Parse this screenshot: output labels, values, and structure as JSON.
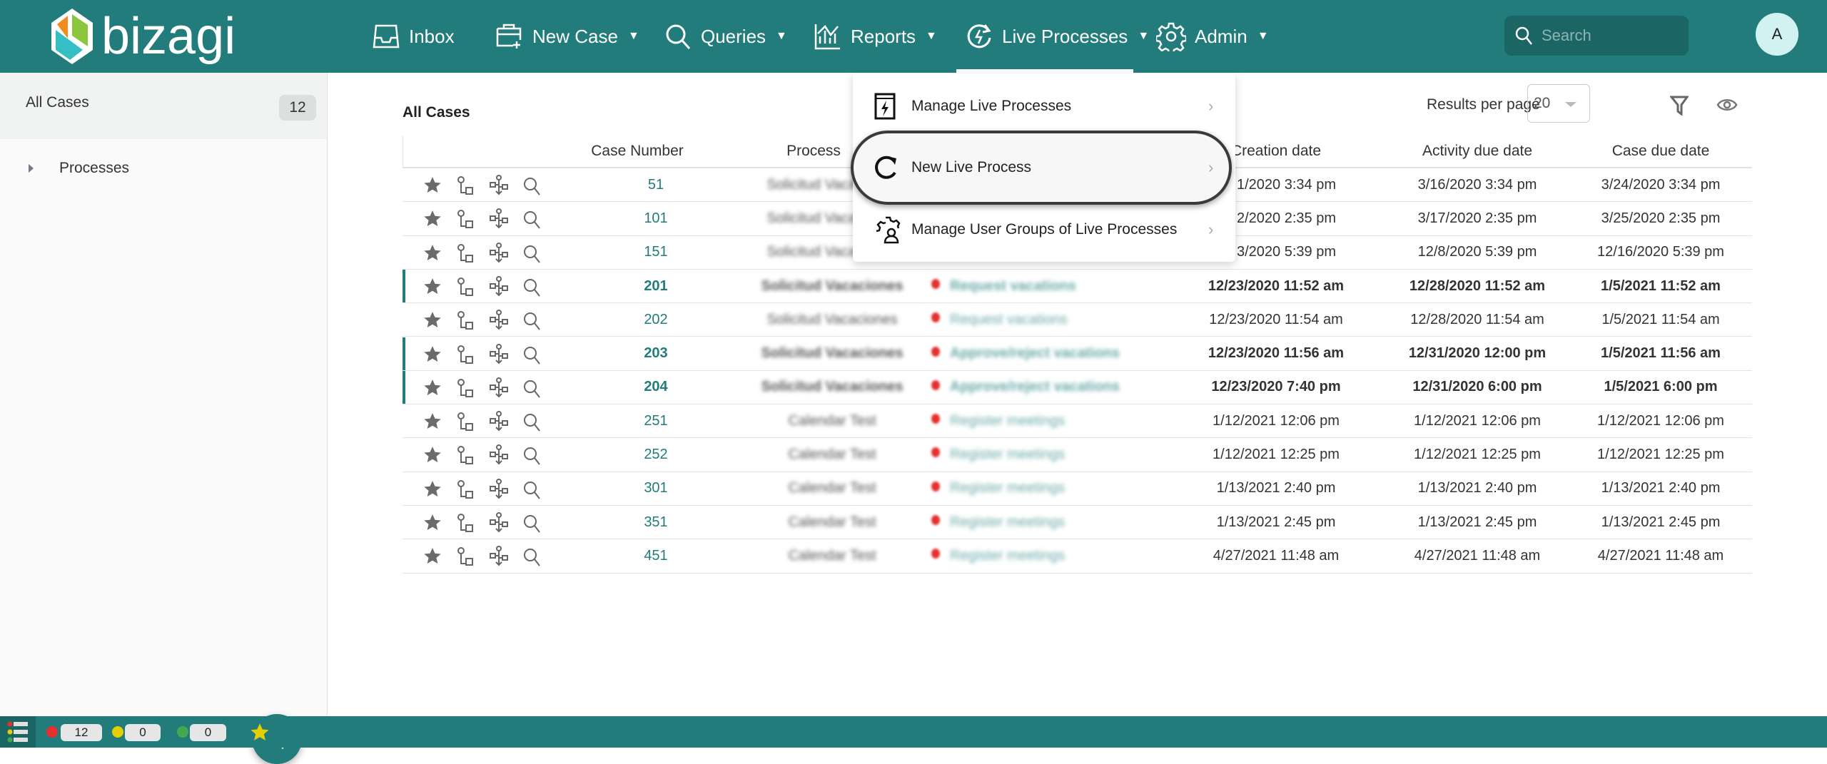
{
  "header": {
    "brand": "bizagi",
    "nav": [
      {
        "label": "Inbox",
        "icon": "inbox-icon"
      },
      {
        "label": "New Case",
        "icon": "new-case-icon"
      },
      {
        "label": "Queries",
        "icon": "search-icon"
      },
      {
        "label": "Reports",
        "icon": "chart-icon"
      },
      {
        "label": "Live Processes",
        "icon": "live-processes-icon",
        "active": true
      },
      {
        "label": "Admin",
        "icon": "gear-icon"
      }
    ],
    "search_placeholder": "Search",
    "avatar": "A",
    "color": "#227c7c"
  },
  "sidebar": {
    "all_cases": "All Cases",
    "all_cases_count": "12",
    "processes": "Processes"
  },
  "main": {
    "title": "All Cases",
    "results_per_page_label": "Results per page",
    "results_per_page": "20",
    "columns": [
      "Case Number",
      "Process",
      "Creation date",
      "Activity due date",
      "Case due date"
    ],
    "columns_visible": {
      "creation": "reation date"
    },
    "rows": [
      {
        "case": "51",
        "process": "Solicitud Vacaciones",
        "activity": "",
        "creation": "1/2020 3:34 pm",
        "activity_due": "3/16/2020 3:34 pm",
        "case_due": "3/24/2020 3:34 pm",
        "bold": false,
        "partial": true
      },
      {
        "case": "101",
        "process": "Solicitud Vacaciones",
        "activity": "",
        "creation": "2/2020 2:35 pm",
        "activity_due": "3/17/2020 2:35 pm",
        "case_due": "3/25/2020 2:35 pm",
        "bold": false,
        "partial": true
      },
      {
        "case": "151",
        "process": "Solicitud Vacaciones",
        "activity": "",
        "creation": "3/2020 5:39 pm",
        "activity_due": "12/8/2020 5:39 pm",
        "case_due": "12/16/2020 5:39 pm",
        "bold": false,
        "partial": true
      },
      {
        "case": "201",
        "process": "Solicitud Vacaciones",
        "activity": "Request vacations",
        "creation": "12/23/2020 11:52 am",
        "activity_due": "12/28/2020 11:52 am",
        "case_due": "1/5/2021 11:52 am",
        "bold": true
      },
      {
        "case": "202",
        "process": "Solicitud Vacaciones",
        "activity": "Request vacations",
        "creation": "12/23/2020 11:54 am",
        "activity_due": "12/28/2020 11:54 am",
        "case_due": "1/5/2021 11:54 am",
        "bold": false
      },
      {
        "case": "203",
        "process": "Solicitud Vacaciones",
        "activity": "Approve/reject vacations",
        "creation": "12/23/2020 11:56 am",
        "activity_due": "12/31/2020 12:00 pm",
        "case_due": "1/5/2021 11:56 am",
        "bold": true
      },
      {
        "case": "204",
        "process": "Solicitud Vacaciones",
        "activity": "Approve/reject vacations",
        "creation": "12/23/2020 7:40 pm",
        "activity_due": "12/31/2020 6:00 pm",
        "case_due": "1/5/2021 6:00 pm",
        "bold": true
      },
      {
        "case": "251",
        "process": "Calendar Test",
        "activity": "Register meetings",
        "creation": "1/12/2021 12:06 pm",
        "activity_due": "1/12/2021 12:06 pm",
        "case_due": "1/12/2021 12:06 pm",
        "bold": false
      },
      {
        "case": "252",
        "process": "Calendar Test",
        "activity": "Register meetings",
        "creation": "1/12/2021 12:25 pm",
        "activity_due": "1/12/2021 12:25 pm",
        "case_due": "1/12/2021 12:25 pm",
        "bold": false
      },
      {
        "case": "301",
        "process": "Calendar Test",
        "activity": "Register meetings",
        "creation": "1/13/2021 2:40 pm",
        "activity_due": "1/13/2021 2:40 pm",
        "case_due": "1/13/2021 2:40 pm",
        "bold": false
      },
      {
        "case": "351",
        "process": "Calendar Test",
        "activity": "Register meetings",
        "creation": "1/13/2021 2:45 pm",
        "activity_due": "1/13/2021 2:45 pm",
        "case_due": "1/13/2021 2:45 pm",
        "bold": false
      },
      {
        "case": "451",
        "process": "Calendar Test",
        "activity": "Register meetings",
        "creation": "4/27/2021 11:48 am",
        "activity_due": "4/27/2021 11:48 am",
        "case_due": "4/27/2021 11:48 am",
        "bold": false
      }
    ]
  },
  "menu": {
    "items": [
      {
        "label": "Manage Live Processes",
        "icon": "lightning-window-icon"
      },
      {
        "label": "New Live Process",
        "icon": "refresh-icon",
        "highlighted": true
      },
      {
        "label": "Manage User Groups of Live Processes",
        "icon": "user-gear-icon"
      }
    ]
  },
  "footer": {
    "red_count": "12",
    "yellow_count": "0",
    "green_count": "0",
    "colors": {
      "red": "#e53030",
      "yellow": "#e3cf00",
      "green": "#45a851"
    }
  }
}
